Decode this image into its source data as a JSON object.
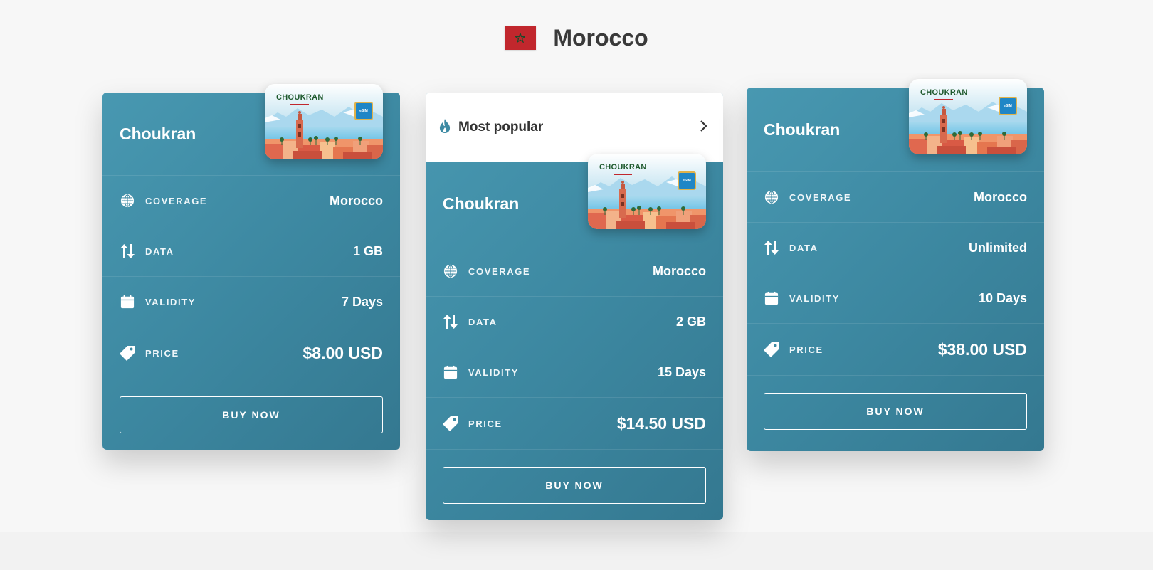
{
  "page": {
    "country": "Morocco",
    "flag_colors": {
      "red": "#c1272d",
      "star": "#006233"
    }
  },
  "colors": {
    "card_gradient_start": "#4898b1",
    "card_gradient_end": "#347890",
    "popular_bg": "#ffffff"
  },
  "sim_card": {
    "brand": "CHOUKRAN",
    "chip_label": "eSIM"
  },
  "labels": {
    "coverage": "COVERAGE",
    "data": "DATA",
    "validity": "VALIDITY",
    "price": "PRICE",
    "buy": "BUY NOW"
  },
  "popular": {
    "label": "Most popular"
  },
  "plans": [
    {
      "name": "Choukran",
      "coverage": "Morocco",
      "data": "1 GB",
      "validity": "7 Days",
      "price": "$8.00 USD"
    },
    {
      "name": "Choukran",
      "coverage": "Morocco",
      "data": "2 GB",
      "validity": "15 Days",
      "price": "$14.50 USD"
    },
    {
      "name": "Choukran",
      "coverage": "Morocco",
      "data": "Unlimited",
      "validity": "10 Days",
      "price": "$38.00 USD"
    }
  ],
  "icons": {
    "coverage": "globe-icon",
    "data": "arrows-up-down-icon",
    "validity": "calendar-icon",
    "price": "price-tag-icon",
    "popular": "flame-icon",
    "popular_chevron": "chevron-right-icon"
  }
}
